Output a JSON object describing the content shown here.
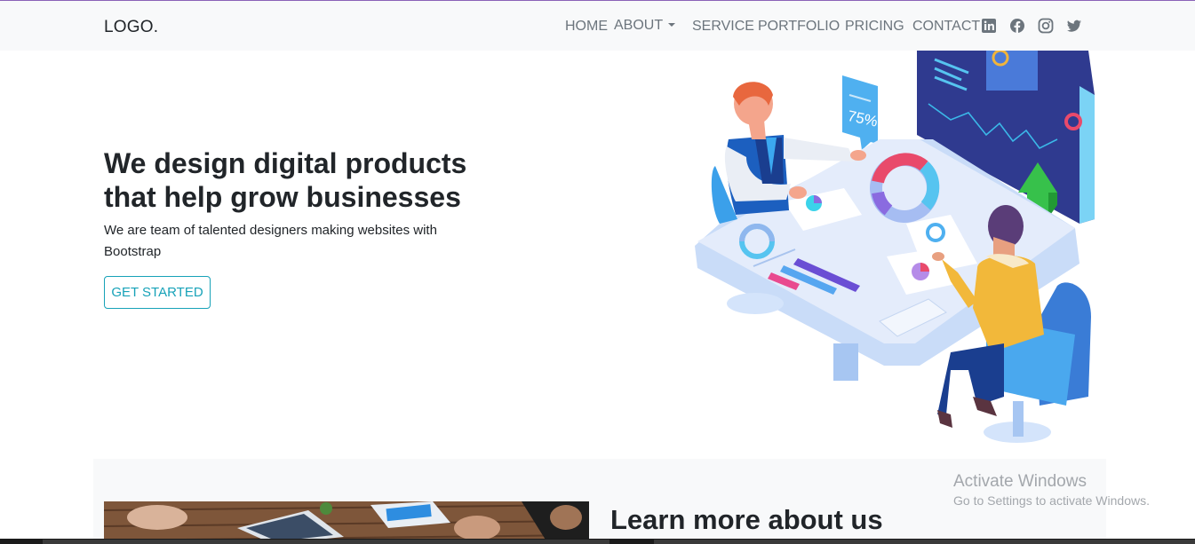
{
  "navbar": {
    "logo": "LOGO.",
    "items": [
      {
        "label": "HOME"
      },
      {
        "label": "ABOUT"
      },
      {
        "label": "SERVICE"
      },
      {
        "label": "PORTFOLIO"
      },
      {
        "label": "PRICING"
      },
      {
        "label": "CONTACT"
      }
    ],
    "social_icons": [
      "linkedin-icon",
      "facebook-icon",
      "instagram-icon",
      "twitter-icon"
    ]
  },
  "hero": {
    "title_line1": "We design digital products",
    "title_line2": "that help grow businesses",
    "subtitle": "We are team of talented designers making websites with Bootstrap",
    "cta_label": "GET STARTED",
    "illustration_text": "75%"
  },
  "about": {
    "title": "Learn more about us"
  },
  "windows_watermark": {
    "line1": "Activate Windows",
    "line2": "Go to Settings to activate Windows."
  },
  "colors": {
    "accent": "#17a2b8",
    "navbar_bg": "#f8f9fa",
    "text": "#212529",
    "muted": "#6c757d"
  }
}
